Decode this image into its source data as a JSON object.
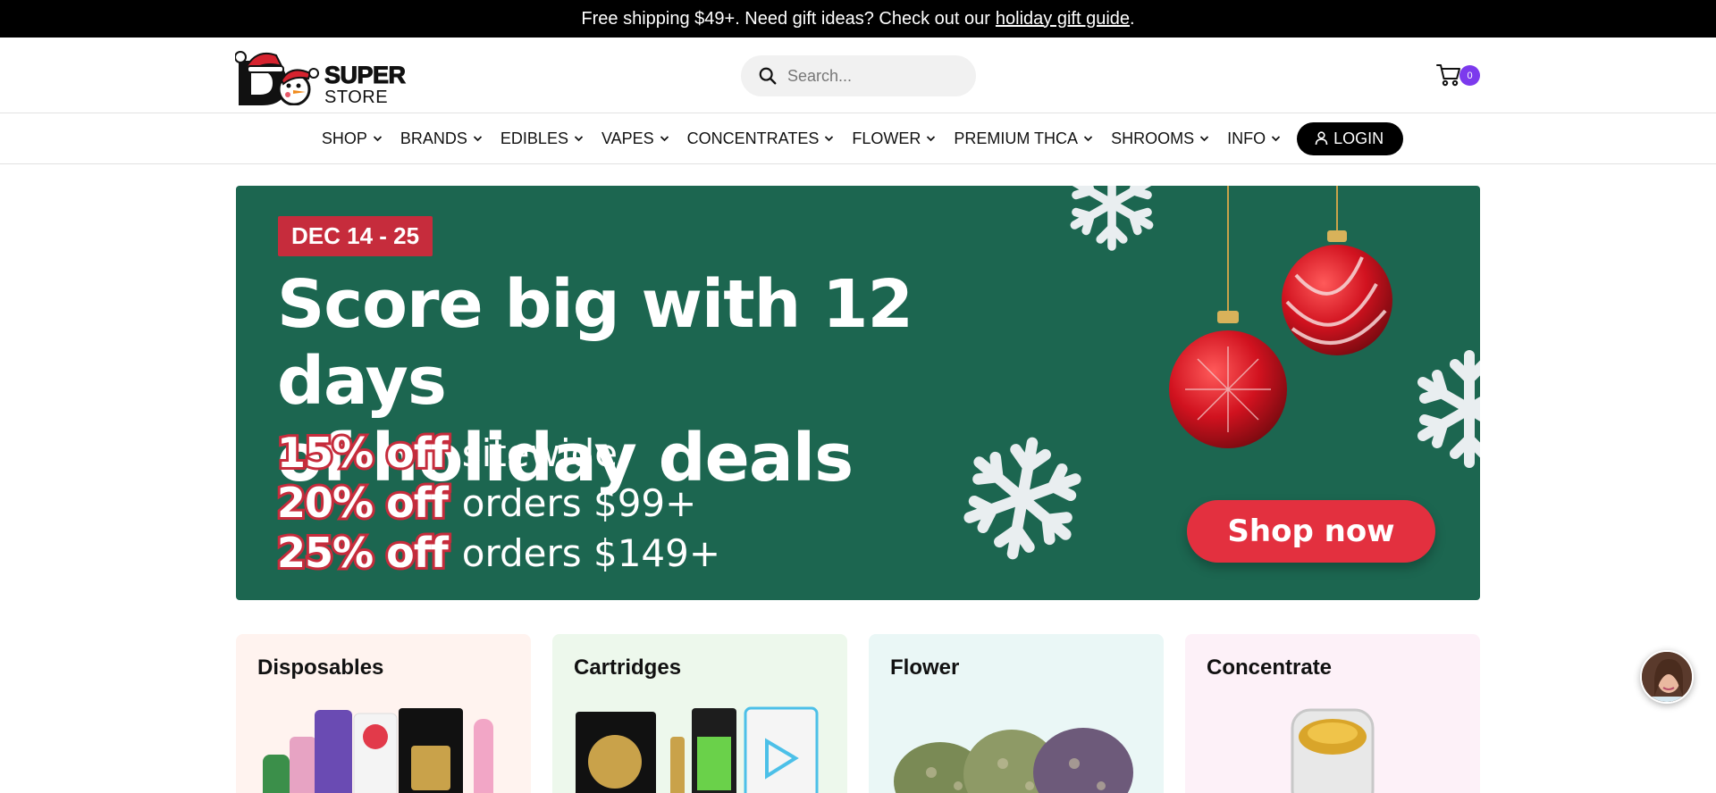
{
  "announcement": {
    "text": "Free shipping $49+. Need gift ideas? Check out our",
    "link": "holiday gift guide",
    "period": "."
  },
  "header": {
    "logo_super": "SUPER",
    "logo_store": "STORE",
    "search_placeholder": "Search...",
    "cart_count": "0"
  },
  "nav": {
    "items": [
      "SHOP",
      "BRANDS",
      "EDIBLES",
      "VAPES",
      "CONCENTRATES",
      "FLOWER",
      "PREMIUM THCA",
      "SHROOMS",
      "INFO"
    ],
    "login": "LOGIN"
  },
  "hero": {
    "date": "DEC 14 - 25",
    "headline_line1": "Score big with 12 days",
    "headline_line2": "of holiday deals",
    "offers": [
      {
        "pct": "15% off",
        "desc": "sitewide"
      },
      {
        "pct": "20% off",
        "desc": "orders $99+"
      },
      {
        "pct": "25% off",
        "desc": "orders $149+"
      }
    ],
    "cta": "Shop now",
    "bg_color": "#1c6650",
    "accent_color": "#c62c3c"
  },
  "categories": [
    {
      "title": "Disposables",
      "bg": "#fff3ef"
    },
    {
      "title": "Cartridges",
      "bg": "#edf8ec"
    },
    {
      "title": "Flower",
      "bg": "#eaf7f6"
    },
    {
      "title": "Concentrate",
      "bg": "#fdf1f8"
    }
  ],
  "icons": {
    "search": "search-icon",
    "cart": "cart-icon",
    "chevron": "chevron-down-icon",
    "user": "user-icon",
    "chat": "chat-avatar"
  }
}
